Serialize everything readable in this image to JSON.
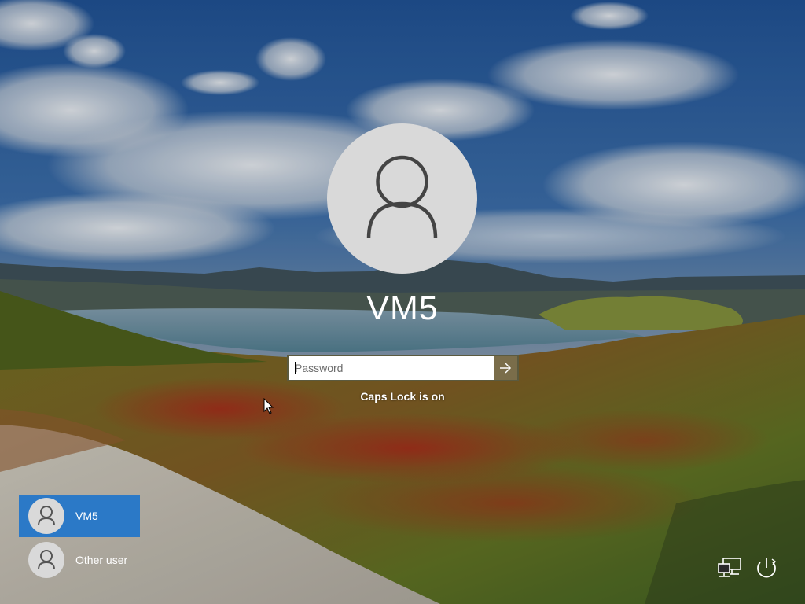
{
  "account": {
    "username": "VM5",
    "avatar_icon": "user-silhouette-icon"
  },
  "password": {
    "placeholder": "Password",
    "value": "",
    "submit_icon": "arrow-right-icon"
  },
  "status": {
    "caps_lock_message": "Caps Lock is on"
  },
  "user_list": [
    {
      "name": "VM5",
      "selected": true,
      "icon": "user-silhouette-icon"
    },
    {
      "name": "Other user",
      "selected": false,
      "icon": "user-silhouette-icon"
    }
  ],
  "system_buttons": {
    "network_icon": "network-icon",
    "power_icon": "power-icon"
  },
  "colors": {
    "selected_tile": "#2b79c7",
    "avatar_bg": "#d9d9d9",
    "submit_button": "#7a6d4a"
  }
}
